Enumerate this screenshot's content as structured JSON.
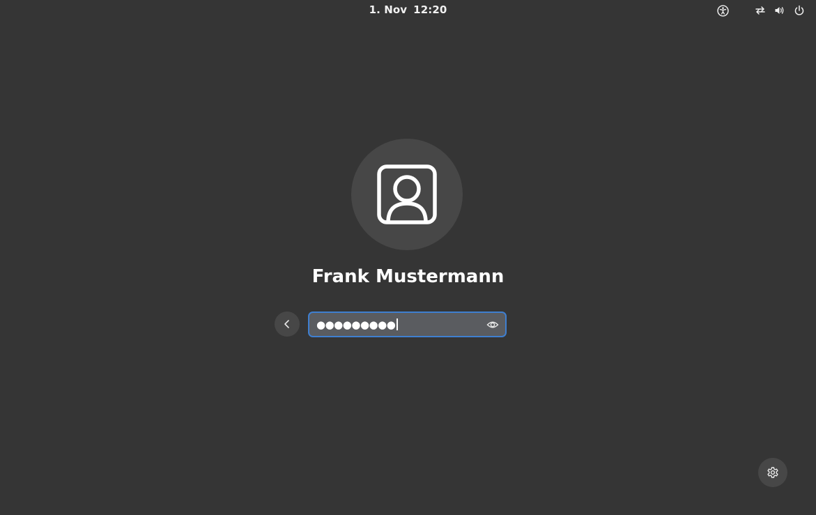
{
  "topbar": {
    "date": "1. Nov",
    "time": "12:20",
    "icons": [
      "accessibility-icon",
      "network-icon",
      "volume-icon",
      "power-icon"
    ]
  },
  "login": {
    "user_name": "Frank Mustermann",
    "password_mask": "●●●●●●●●●",
    "avatar_icon": "user-avatar-icon",
    "back_icon": "chevron-left-icon",
    "reveal_icon": "eye-icon"
  },
  "footer": {
    "settings_icon": "gear-icon"
  },
  "colors": {
    "background": "#353535",
    "button_bg": "#474747",
    "field_bg": "#5a5c60",
    "focus_border": "#3f7fd0"
  }
}
